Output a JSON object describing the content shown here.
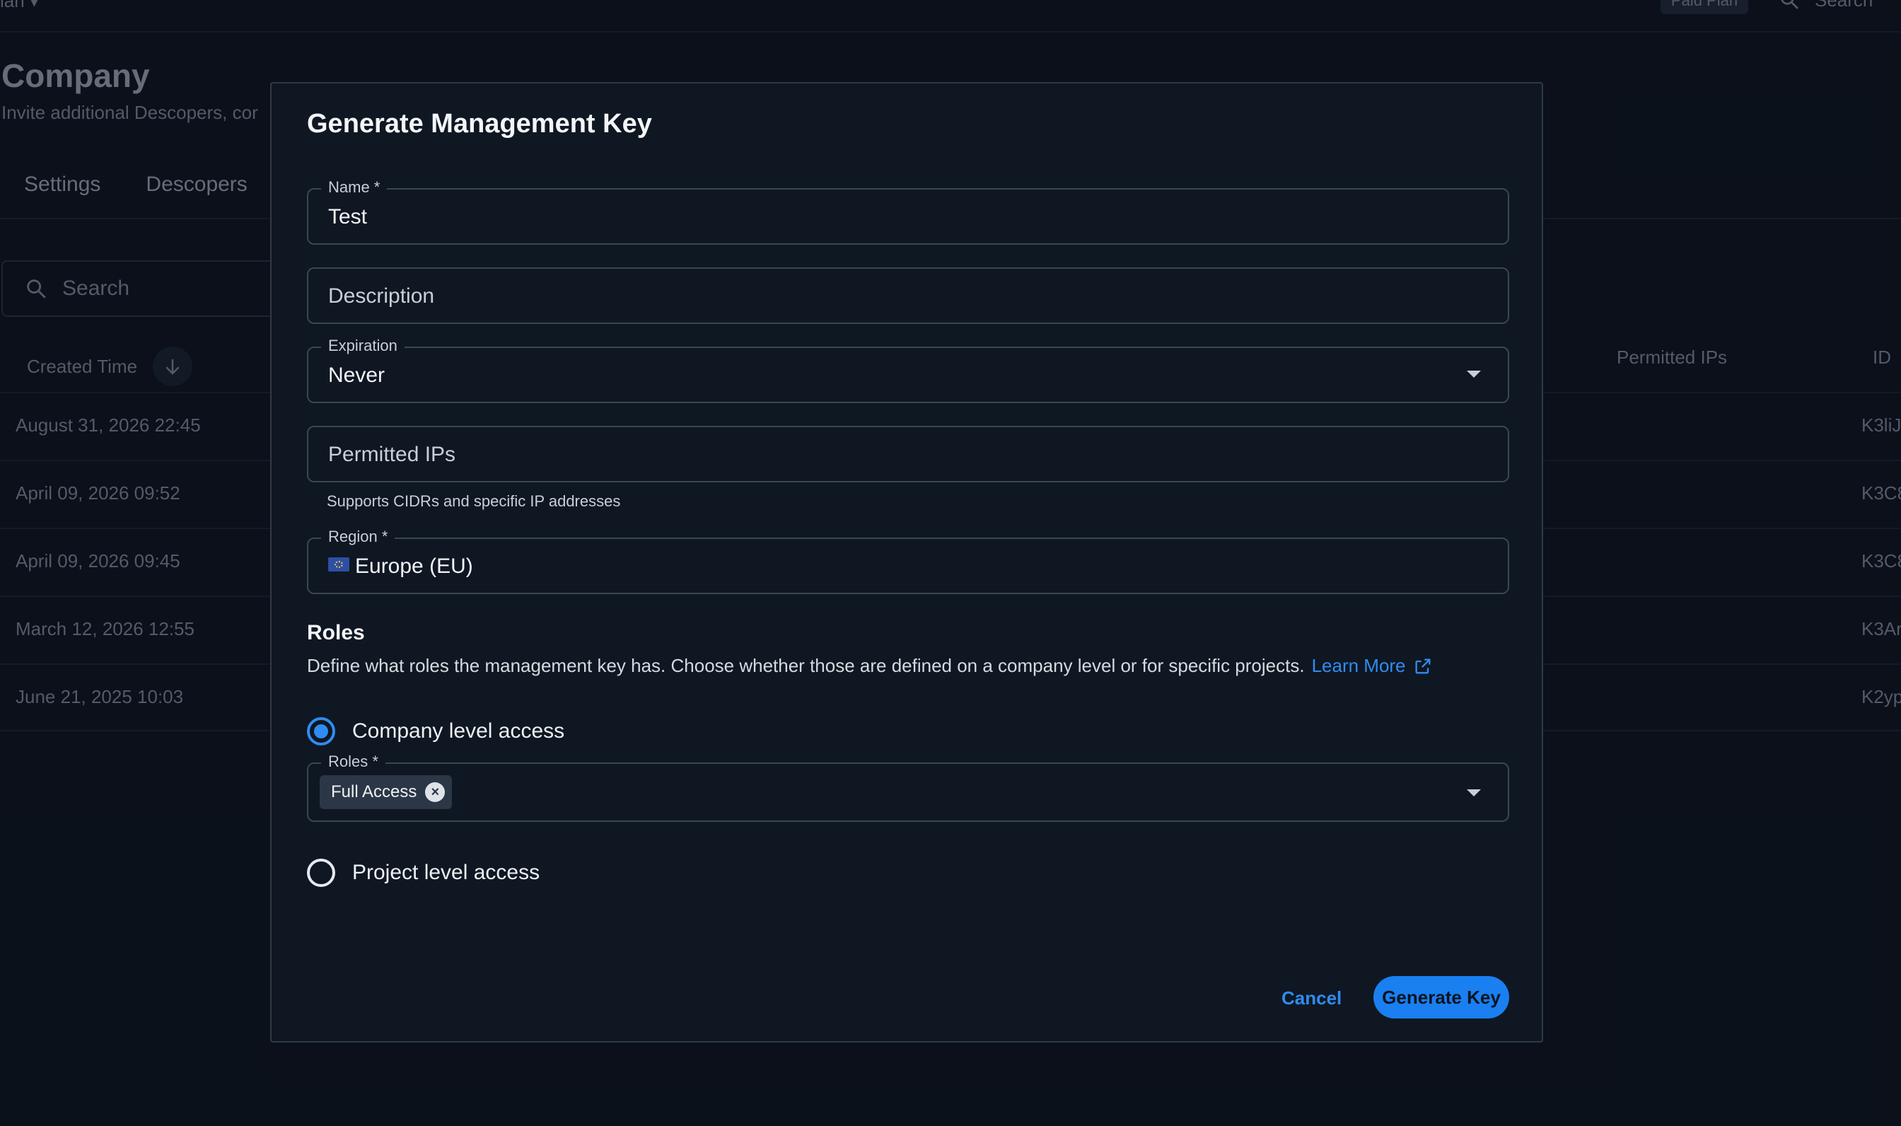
{
  "background": {
    "topbar": {
      "left_text": "ian",
      "plan_badge": "Paid Plan",
      "search_label": "Search"
    },
    "page_title": "Company",
    "page_subtitle": "Invite additional Descopers, cor",
    "tabs": [
      "Settings",
      "Descopers"
    ],
    "search_placeholder": "Search",
    "columns": {
      "created_time": "Created Time",
      "permitted_ips": "Permitted IPs",
      "id": "ID"
    },
    "rows": [
      {
        "time": "August 31, 2026 22:45",
        "id": "K3liJ"
      },
      {
        "time": "April 09, 2026 09:52",
        "id": "K3C8"
      },
      {
        "time": "April 09, 2026 09:45",
        "id": "K3C8"
      },
      {
        "time": "March 12, 2026 12:55",
        "id": "K3Ar"
      },
      {
        "time": "June 21, 2025 10:03",
        "id": "K2yp"
      }
    ]
  },
  "modal": {
    "title": "Generate Management Key",
    "name": {
      "label": "Name *",
      "value": "Test"
    },
    "description": {
      "placeholder": "Description"
    },
    "expiration": {
      "label": "Expiration",
      "value": "Never"
    },
    "permitted_ips": {
      "placeholder": "Permitted IPs",
      "helper": "Supports CIDRs and specific IP addresses"
    },
    "region": {
      "label": "Region *",
      "value": "Europe (EU)",
      "flag_icon": "eu-flag-icon"
    },
    "roles": {
      "heading": "Roles",
      "description": "Define what roles the management key has. Choose whether those are defined on a company level or for specific projects.",
      "learn_more": "Learn More",
      "company_level": "Company level access",
      "roles_field_label": "Roles *",
      "selected_roles": [
        "Full Access"
      ],
      "project_level": "Project level access",
      "selected_option": "company"
    },
    "actions": {
      "cancel": "Cancel",
      "generate": "Generate Key"
    },
    "accent_color": "#2f8cf0"
  }
}
